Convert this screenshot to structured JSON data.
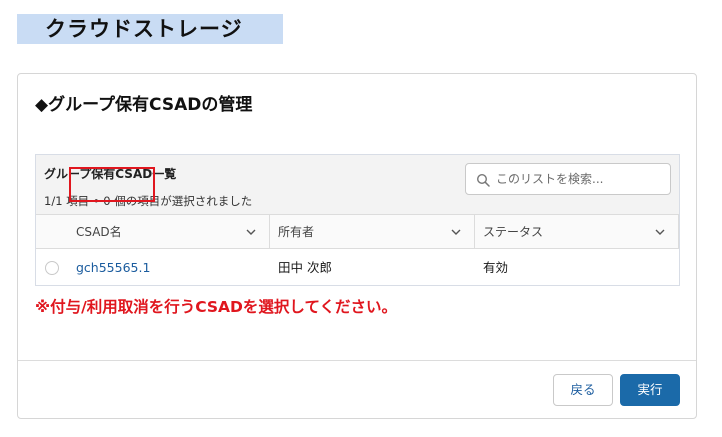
{
  "page": {
    "title": "クラウドストレージ"
  },
  "card": {
    "title": "◆グループ保有CSADの管理"
  },
  "list": {
    "title": "グループ保有CSAD一覧",
    "meta": "1/1 項目 • 0 個の項目が選択されました",
    "search_placeholder": "このリストを検索...",
    "columns": [
      "CSAD名",
      "所有者",
      "ステータス"
    ],
    "rows": [
      {
        "csad_name": "gch55565.1",
        "owner": "田中 次郎",
        "status": "有効"
      }
    ]
  },
  "notice": "※付与/利用取消を行うCSADを選択してください。",
  "buttons": {
    "back": "戻る",
    "run": "実行"
  },
  "colors": {
    "accent": "#1b6aa9",
    "link": "#1b5c9e",
    "warning": "#e0161e",
    "title_bg": "#c9dcf4"
  },
  "icons": [
    "search-icon",
    "chevron-down-icon"
  ]
}
